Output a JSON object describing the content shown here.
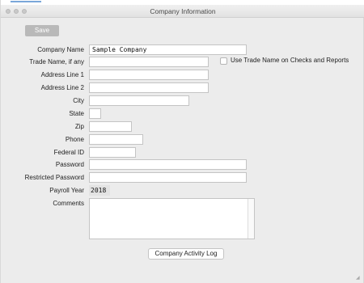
{
  "window": {
    "title": "Company Information"
  },
  "toolbar": {
    "save_label": "Save"
  },
  "form": {
    "company_name": {
      "label": "Company Name",
      "value": "Sample Company"
    },
    "trade_name": {
      "label": "Trade Name, if any",
      "value": ""
    },
    "use_trade_name": {
      "label": "Use Trade Name on Checks and Reports",
      "checked": false
    },
    "address_line_1": {
      "label": "Address Line 1",
      "value": ""
    },
    "address_line_2": {
      "label": "Address Line 2",
      "value": ""
    },
    "city": {
      "label": "City",
      "value": ""
    },
    "state": {
      "label": "State",
      "value": ""
    },
    "zip": {
      "label": "Zip",
      "value": ""
    },
    "phone": {
      "label": "Phone",
      "value": ""
    },
    "federal_id": {
      "label": "Federal ID",
      "value": ""
    },
    "password": {
      "label": "Password",
      "value": ""
    },
    "restricted_password": {
      "label": "Restricted Password",
      "value": ""
    },
    "payroll_year": {
      "label": "Payroll Year",
      "value": "2018"
    },
    "comments": {
      "label": "Comments",
      "value": ""
    }
  },
  "footer": {
    "activity_log_label": "Company Activity Log"
  }
}
